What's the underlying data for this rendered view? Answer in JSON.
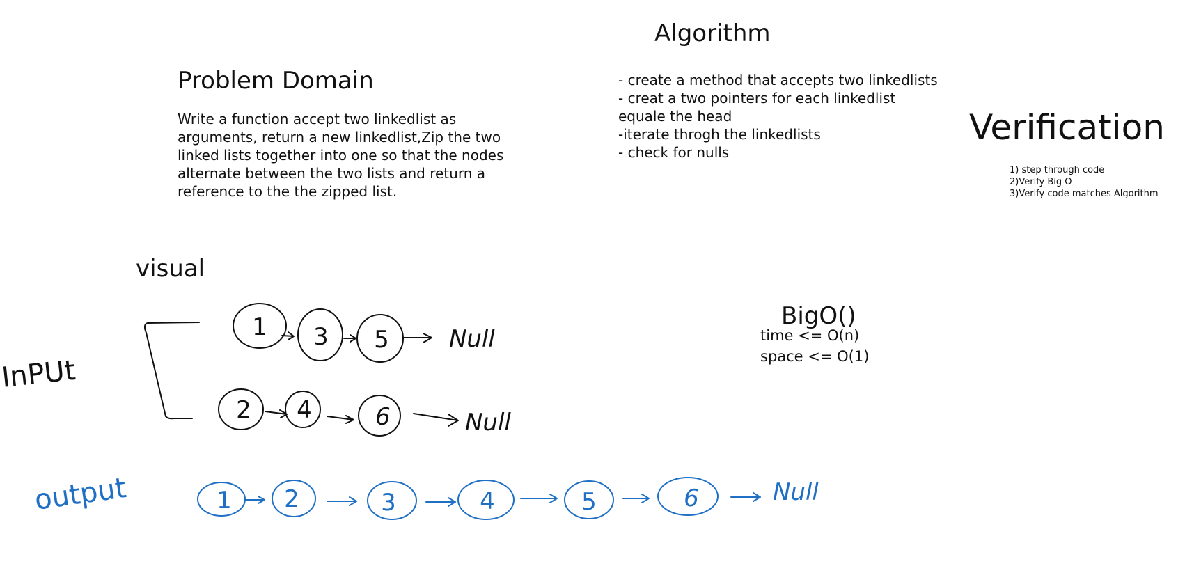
{
  "algorithm": {
    "title": "Algorithm",
    "steps": [
      "- create a method that accepts two linkedlists",
      "- creat a two pointers for each linkedlist equale the head",
      "-iterate throgh the linkedlists",
      "- check for nulls"
    ]
  },
  "problem_domain": {
    "title": "Problem Domain",
    "text": "Write a function accept two linkedlist as arguments, return a new linkedlist,Zip the two linked lists together into one so that the nodes alternate between the two lists and return a reference to the the zipped list."
  },
  "verification": {
    "title": "Verification",
    "items": [
      "1) step through code",
      "2)Verify Big O",
      "3)Verify code matches Algorithm"
    ]
  },
  "visual": {
    "title": "visual"
  },
  "bigo": {
    "title": "BigO()",
    "time": "time <= O(n)",
    "space": "space <= O(1)"
  },
  "diagram": {
    "input_label": "InPUt",
    "output_label": "output",
    "list_a": [
      "1",
      "3",
      "5"
    ],
    "list_b": [
      "2",
      "4",
      "6"
    ],
    "output_list": [
      "1",
      "2",
      "3",
      "4",
      "5",
      "6"
    ],
    "null_label": "Null",
    "null_label_output": "Null",
    "ink_color": "#111111",
    "output_color": "#1f6fc4"
  }
}
